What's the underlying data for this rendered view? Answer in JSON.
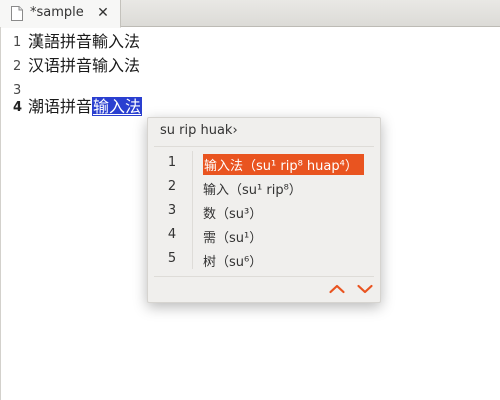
{
  "tab": {
    "title": "*sample",
    "close_glyph": "✕",
    "file_icon": "document-icon",
    "close_icon": "close-icon"
  },
  "editor": {
    "lines": [
      {
        "number": "1",
        "text": "漢語拼音輸入法"
      },
      {
        "number": "2",
        "text": "汉语拼音输入法"
      },
      {
        "number": "3",
        "text": ""
      },
      {
        "number": "4",
        "text": "潮语拼音",
        "preedit": "输入法"
      }
    ]
  },
  "ime_popup": {
    "preedit": "su rip huak›",
    "candidates": [
      {
        "index": "1",
        "text": "输入法（su¹ rip⁸ huap⁴）",
        "selected": true
      },
      {
        "index": "2",
        "text": "输入（su¹ rip⁸）",
        "selected": false
      },
      {
        "index": "3",
        "text": "数（su³）",
        "selected": false
      },
      {
        "index": "4",
        "text": "需（su¹）",
        "selected": false
      },
      {
        "index": "5",
        "text": "树（su⁶）",
        "selected": false
      }
    ],
    "page_up_icon": "chevron-up-icon",
    "page_down_icon": "chevron-down-icon"
  },
  "colors": {
    "selection": "#2a3fd0",
    "candidate_highlight": "#e95420",
    "arrow_accent": "#e95420"
  }
}
